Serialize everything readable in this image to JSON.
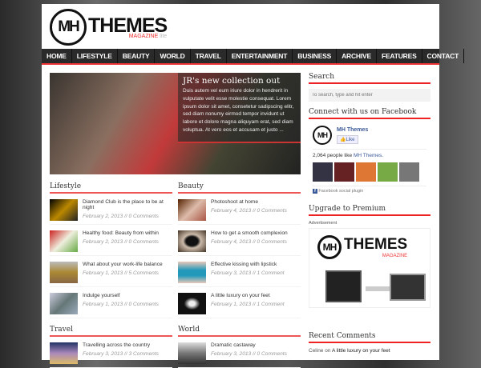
{
  "logo": {
    "mark": "MH",
    "name": "THEMES",
    "sub": "MAGAZINE",
    "lite": "lite"
  },
  "nav": [
    "HOME",
    "LIFESTYLE",
    "BEAUTY",
    "WORLD",
    "TRAVEL",
    "ENTERTAINMENT",
    "BUSINESS",
    "ARCHIVE",
    "FEATURES",
    "CONTACT"
  ],
  "slider": {
    "title": "JR's new collection out",
    "text": "Duis autem vel eum iriure dolor in hendrerit in vulputate velit esse molestie consequat. Lorem ipsum dolor sit amet, consetetur sadipscing elitr, sed diam nonumy eirmod tempor invidunt ut labore et dolore magna aliquyam erat, sed diam voluptua. At vero eos et accusam et justo ..."
  },
  "sections": [
    {
      "title": "Lifestyle",
      "items": [
        {
          "title": "Diamond Club is the place to be at night",
          "meta": "February 2, 2013 // 0 Comments"
        },
        {
          "title": "Healthy food: Beauty from within",
          "meta": "February 2, 2013 // 0 Comments"
        },
        {
          "title": "What about your work-life balance",
          "meta": "February 1, 2013 // 5 Comments"
        },
        {
          "title": "Indulge yourself",
          "meta": "February 1, 2013 // 0 Comments"
        }
      ]
    },
    {
      "title": "Beauty",
      "items": [
        {
          "title": "Photoshoot at home",
          "meta": "February 4, 2013 // 0 Comments"
        },
        {
          "title": "How to get a smooth complexion",
          "meta": "February 4, 2013 // 0 Comments"
        },
        {
          "title": "Effective kissing with lipstick",
          "meta": "February 3, 2013 // 1 Comment"
        },
        {
          "title": "A little luxury on your feet",
          "meta": "February 1, 2013 // 1 Comment"
        }
      ]
    },
    {
      "title": "Travel",
      "items": [
        {
          "title": "Travelling across the country",
          "meta": "February 3, 2013 // 3 Comments"
        }
      ]
    },
    {
      "title": "World",
      "items": [
        {
          "title": "Dramatic castaway",
          "meta": "February 3, 2013 // 0 Comments"
        }
      ]
    }
  ],
  "sidebar": {
    "search_title": "Search",
    "search_placeholder": "To search, type and hit enter",
    "fb_title": "Connect with us on Facebook",
    "fb_name": "MH Themes",
    "fb_like": "Like",
    "fb_count": "2,064 people like",
    "fb_link": "MH Themes.",
    "fb_plugin": "Facebook social plugin",
    "premium_title": "Upgrade to Premium",
    "ad_label": "Advertisement",
    "recent_title": "Recent Comments",
    "recent_author": "Celine",
    "recent_on": "on",
    "recent_post": "A little luxury on your feet"
  }
}
